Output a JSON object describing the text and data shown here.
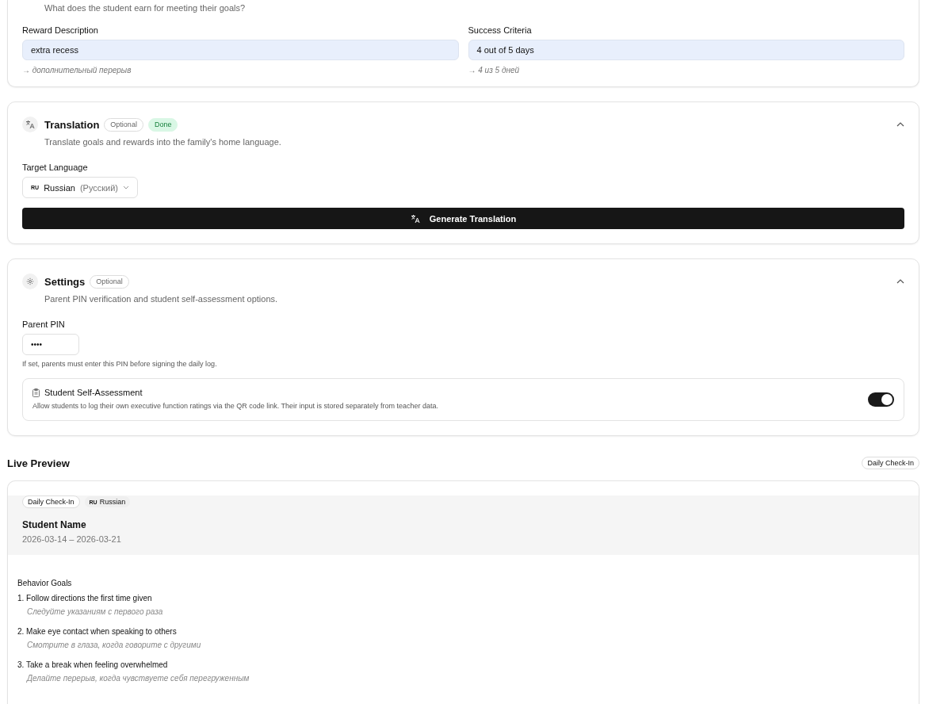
{
  "reward_section": {
    "subtitle": "What does the student earn for meeting their goals?",
    "fields": [
      {
        "label": "Reward Description",
        "value": "extra recess",
        "translation": "→ дополнительный перерыв"
      },
      {
        "label": "Success Criteria",
        "value": "4 out of 5 days",
        "translation": "→ 4 из 5 дней"
      }
    ]
  },
  "translation_section": {
    "title": "Translation",
    "expanded": true,
    "badges": [
      {
        "label": "Optional",
        "kind": "optional"
      },
      {
        "label": "Done",
        "kind": "done"
      }
    ],
    "description": "Translate goals and rewards into the family's home language.",
    "target_language": {
      "label": "Target Language",
      "code": "RU",
      "name": "Russian",
      "native": "(Русский)"
    },
    "button": "Generate Translation"
  },
  "settings_section": {
    "title": "Settings",
    "expanded": true,
    "badges": [
      {
        "label": "Optional",
        "kind": "optional"
      }
    ],
    "description": "Parent PIN verification and student self-assessment options.",
    "pin": {
      "label": "Parent PIN",
      "value": "••••",
      "hint": "If set, parents must enter this PIN before signing the daily log."
    },
    "self_assessment": {
      "title": "Student Self-Assessment",
      "description": "Allow students to log their own executive function ratings via the QR code link. Their input is stored separately from teacher data.",
      "on": true
    }
  },
  "live_preview": {
    "title": "Live Preview",
    "badge": "Daily Check-In",
    "tags": [
      {
        "kind": "outline",
        "label": "Daily Check-In"
      },
      {
        "kind": "language",
        "code": "RU",
        "label": "Russian"
      }
    ],
    "student_name": "Student Name",
    "dates": "2026-03-14 – 2026-03-21",
    "goals_heading": "Behavior Goals",
    "goals": [
      {
        "text": "1. Follow directions the first time given",
        "translation": "Следуйте указаниям с первого раза"
      },
      {
        "text": "2. Make eye contact when speaking to others",
        "translation": "Смотрите в глаза, когда говорите с другими"
      },
      {
        "text": "3. Take a break when feeling overwhelmed",
        "translation": "Делайте перерыв, когда чувствуете себя перегруженным"
      }
    ]
  }
}
